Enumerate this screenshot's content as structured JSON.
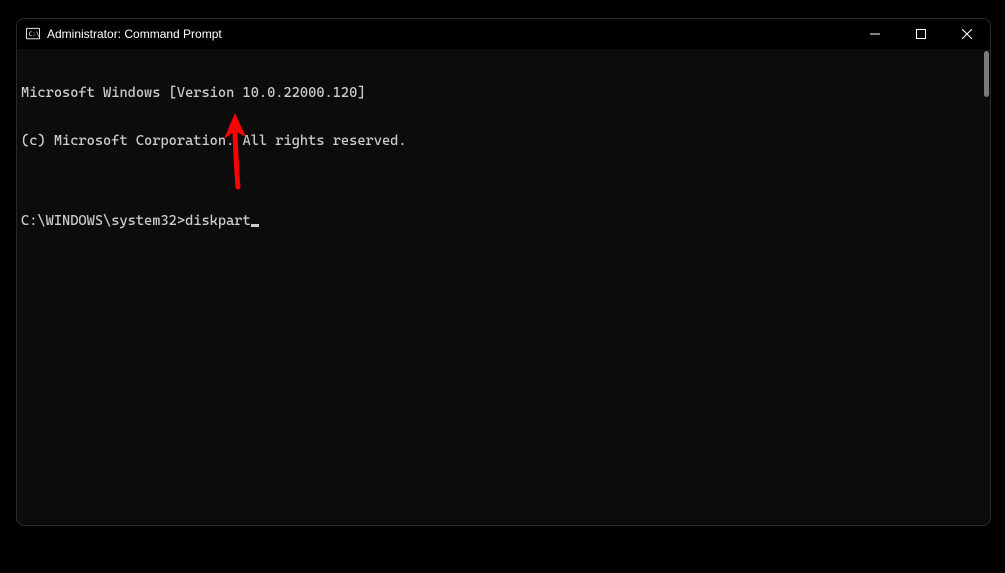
{
  "window": {
    "title": "Administrator: Command Prompt"
  },
  "terminal": {
    "line1": "Microsoft Windows [Version 10.0.22000.120]",
    "line2": "(c) Microsoft Corporation. All rights reserved.",
    "blank": "",
    "prompt_path": "C:\\WINDOWS\\system32>",
    "command": "diskpart"
  }
}
